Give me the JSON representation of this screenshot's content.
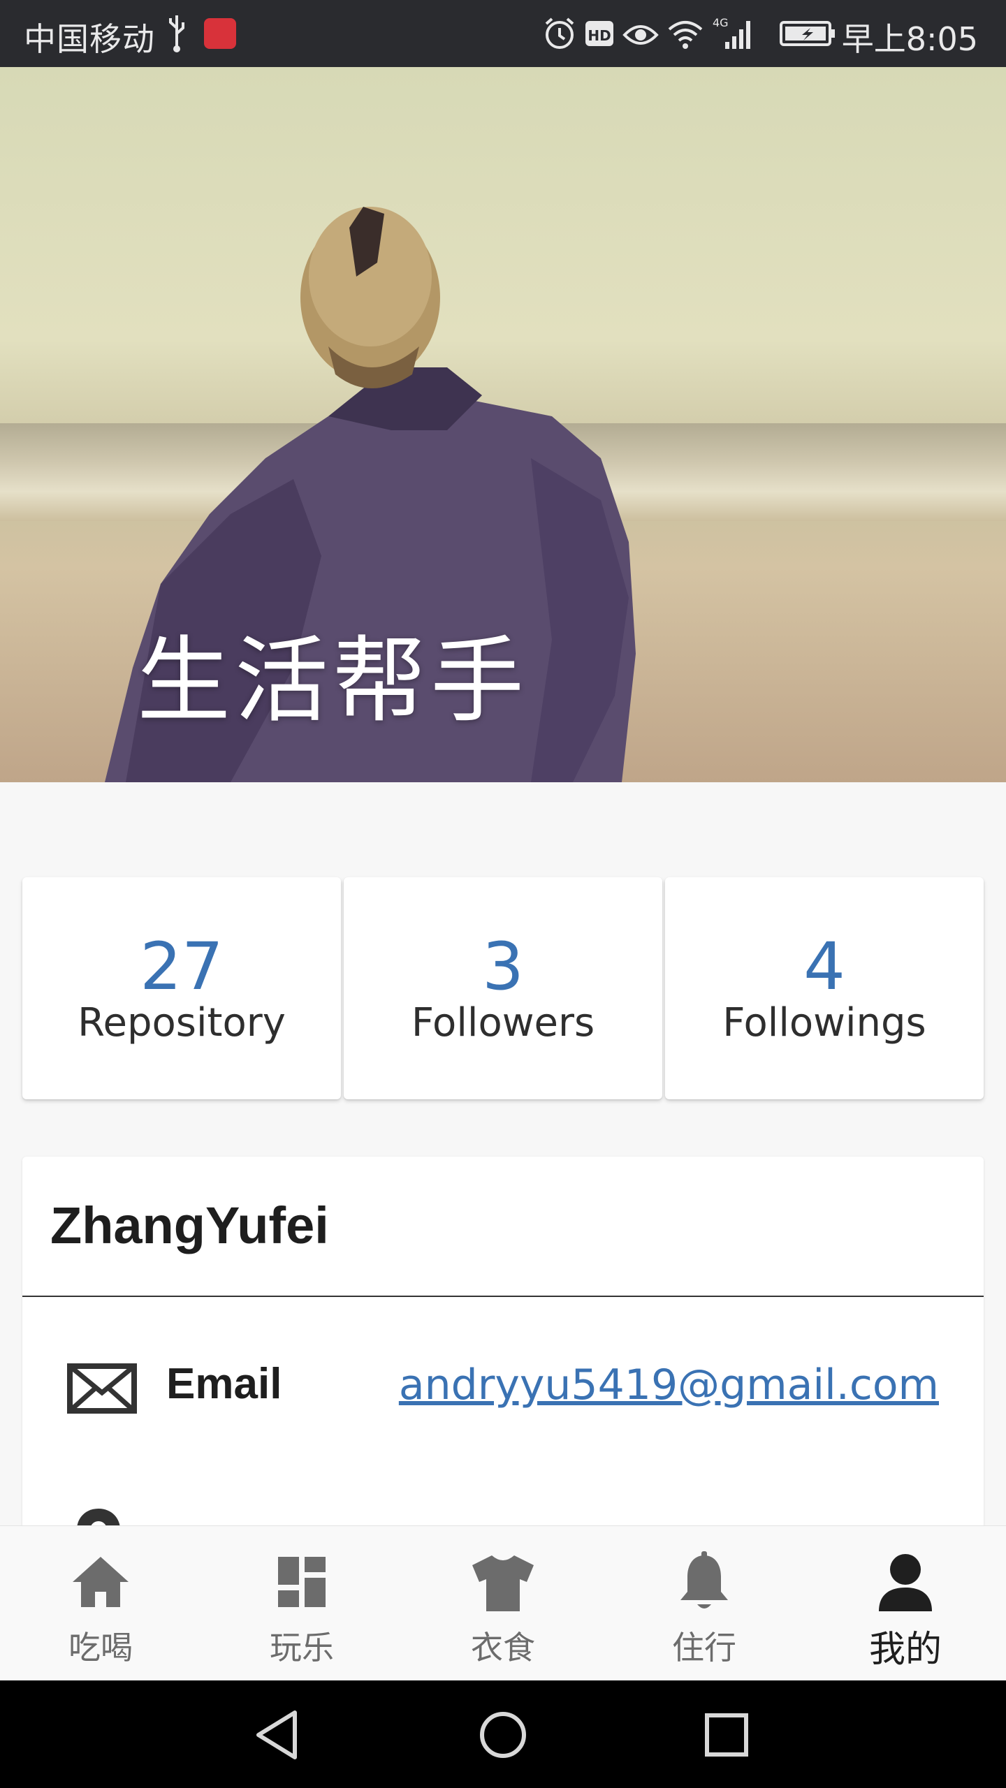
{
  "status_bar": {
    "carrier": "中国移动",
    "network": "4G",
    "time": "早上8:05"
  },
  "hero": {
    "title": "生活帮手"
  },
  "stats": [
    {
      "number": "27",
      "label": "Repository"
    },
    {
      "number": "3",
      "label": "Followers"
    },
    {
      "number": "4",
      "label": "Followings"
    }
  ],
  "profile": {
    "name": "ZhangYufei",
    "email_label": "Email",
    "email_value": "andryyu5419@gmail.com"
  },
  "bottom_nav": {
    "items": [
      {
        "label": "吃喝",
        "icon": "home-icon"
      },
      {
        "label": "玩乐",
        "icon": "dashboard-icon"
      },
      {
        "label": "衣食",
        "icon": "tshirt-icon"
      },
      {
        "label": "住行",
        "icon": "bell-icon"
      },
      {
        "label": "我的",
        "icon": "person-icon",
        "active": true
      }
    ]
  },
  "colors": {
    "accent": "#3a72b3",
    "status_bar": "#2a2b2f",
    "nav_inactive": "#6c6c6c",
    "nav_active": "#1f1f1f"
  }
}
